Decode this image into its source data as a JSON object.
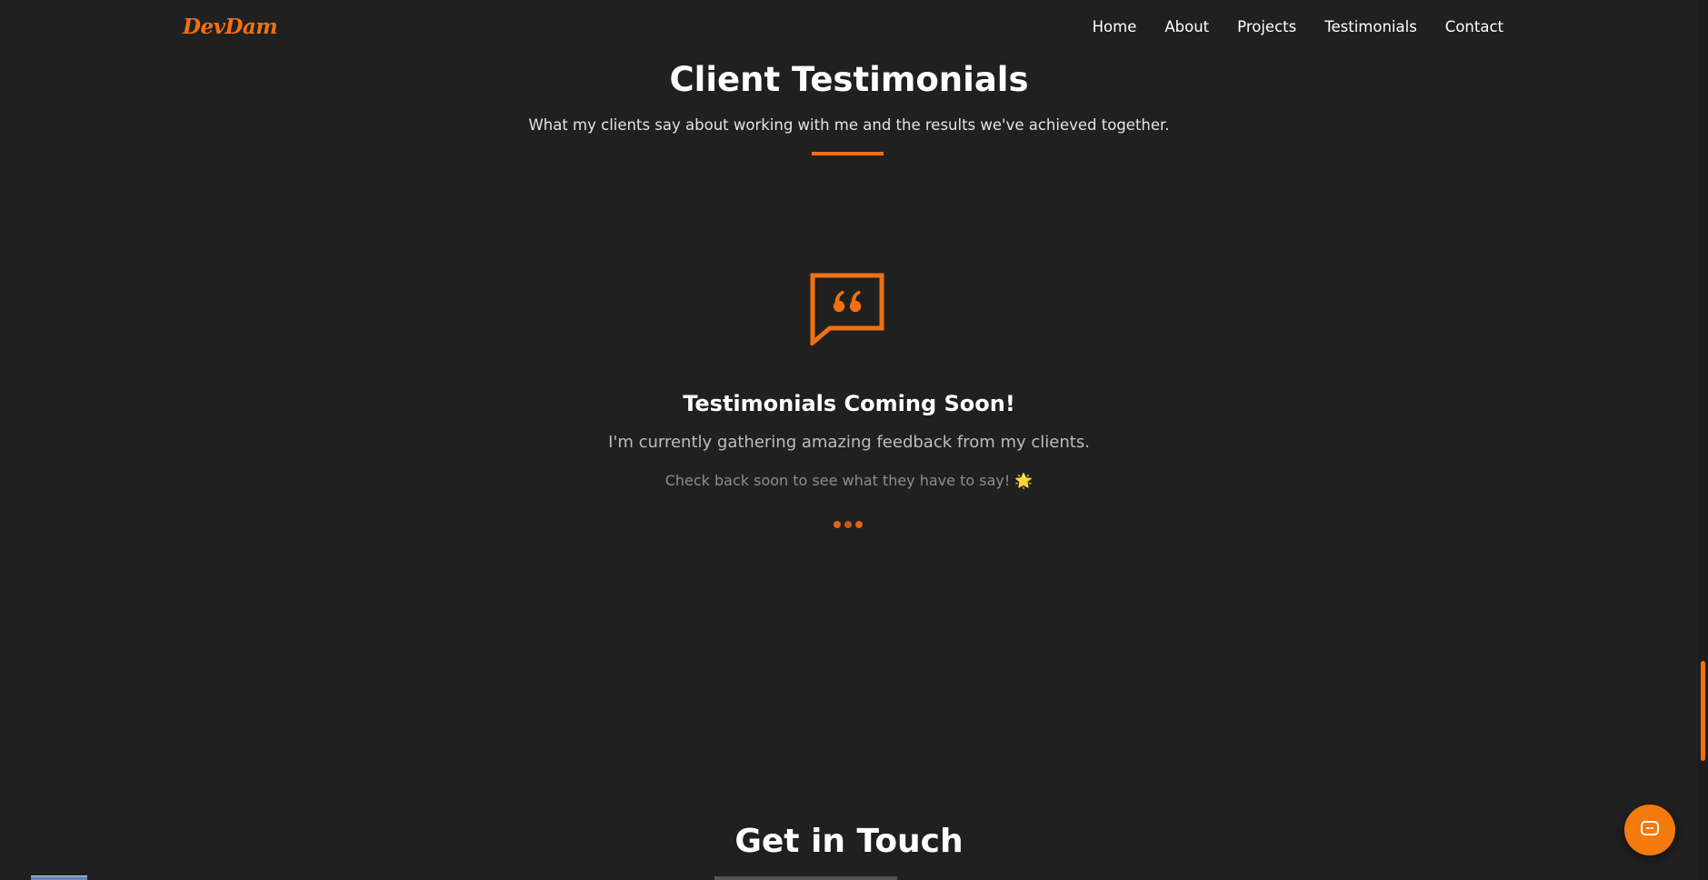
{
  "navbar": {
    "logo": "DevDam",
    "links": [
      "Home",
      "About",
      "Projects",
      "Testimonials",
      "Contact"
    ]
  },
  "testimonials": {
    "title": "Client Testimonials",
    "subtitle": "What my clients say about working with me and the results we've achieved together.",
    "empty_title": "Testimonials Coming Soon!",
    "empty_text": "I'm currently gathering amazing feedback from my clients.",
    "empty_subtext": "Check back soon to see what they have to say! 🌟",
    "icon": "quote-bubble-icon"
  },
  "contact": {
    "title": "Get in Touch"
  },
  "chat": {
    "icon": "chat-bot-icon"
  },
  "colors": {
    "background": "#202020",
    "accent": "#f07014",
    "text": "#ffffff",
    "muted": "#bdbdbd"
  }
}
